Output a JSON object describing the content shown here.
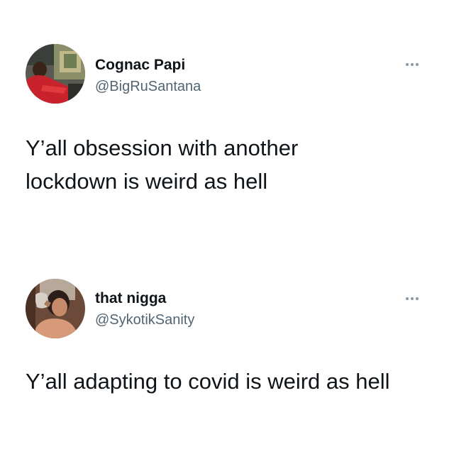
{
  "tweets": [
    {
      "display_name": "Cognac Papi",
      "handle": "@BigRuSantana",
      "text": "Y’all obsession with another\nlockdown is weird as hell",
      "more_icon": "more-horizontal-icon"
    },
    {
      "display_name": "that nigga",
      "handle": "@SykotikSanity",
      "text": "Y’all adapting to covid is weird as hell",
      "more_icon": "more-horizontal-icon"
    }
  ],
  "colors": {
    "text_primary": "#0f1419",
    "text_secondary": "#536471",
    "more_dots": "#8b98a5",
    "background": "#ffffff"
  }
}
